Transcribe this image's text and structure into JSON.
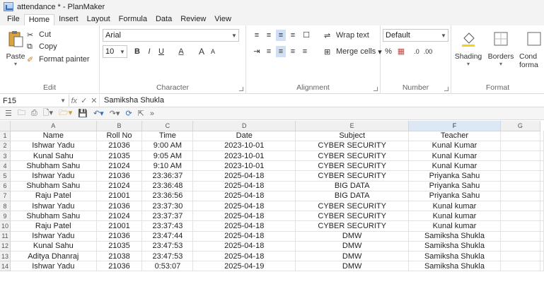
{
  "window": {
    "title": "attendance * - PlanMaker"
  },
  "menu": [
    "File",
    "Home",
    "Insert",
    "Layout",
    "Formula",
    "Data",
    "Review",
    "View"
  ],
  "ribbon": {
    "edit": {
      "label": "Edit",
      "paste": "Paste",
      "cut": "Cut",
      "copy": "Copy",
      "format_painter": "Format painter"
    },
    "character": {
      "label": "Character",
      "font": "Arial",
      "size": "10",
      "bold": "B",
      "italic": "I",
      "underline": "U",
      "font_color": "A",
      "grow": "A",
      "shrink": "A"
    },
    "alignment": {
      "label": "Alignment",
      "wrap": "Wrap text",
      "merge": "Merge cells"
    },
    "number": {
      "label": "Number",
      "format": "Default",
      "percent": "%"
    },
    "format": {
      "label": "Format",
      "shading": "Shading",
      "borders": "Borders",
      "conditional": "Cond",
      "conditional2": "forma"
    }
  },
  "formula_bar": {
    "cell": "F15",
    "fx": "fx",
    "value": "Samiksha Shukla"
  },
  "columns": [
    "A",
    "B",
    "C",
    "D",
    "E",
    "F",
    "G"
  ],
  "rows": [
    {
      "n": "1",
      "cells": [
        "Name",
        "Roll No",
        "Time",
        "Date",
        "Subject",
        "Teacher",
        ""
      ]
    },
    {
      "n": "2",
      "cells": [
        "Ishwar Yadu",
        "21036",
        "9:00 AM",
        "2023-10-01",
        "CYBER SECURITY",
        "Kunal Kumar",
        ""
      ]
    },
    {
      "n": "3",
      "cells": [
        "Kunal Sahu",
        "21035",
        "9:05 AM",
        "2023-10-01",
        "CYBER SECURITY",
        "Kunal Kumar",
        ""
      ]
    },
    {
      "n": "4",
      "cells": [
        "Shubham Sahu",
        "21024",
        "9:10 AM",
        "2023-10-01",
        "CYBER SECURITY",
        "Kunal Kumar",
        ""
      ]
    },
    {
      "n": "5",
      "cells": [
        "Ishwar Yadu",
        "21036",
        "23:36:37",
        "2025-04-18",
        "CYBER SECURITY",
        "Priyanka Sahu",
        ""
      ]
    },
    {
      "n": "6",
      "cells": [
        "Shubham Sahu",
        "21024",
        "23:36:48",
        "2025-04-18",
        "BIG DATA",
        "Priyanka Sahu",
        ""
      ]
    },
    {
      "n": "7",
      "cells": [
        "Raju Patel",
        "21001",
        "23:36:56",
        "2025-04-18",
        "BIG DATA",
        "Priyanka Sahu",
        ""
      ]
    },
    {
      "n": "8",
      "cells": [
        "Ishwar Yadu",
        "21036",
        "23:37:30",
        "2025-04-18",
        "CYBER SECURITY",
        "Kunal kumar",
        ""
      ]
    },
    {
      "n": "9",
      "cells": [
        "Shubham Sahu",
        "21024",
        "23:37:37",
        "2025-04-18",
        "CYBER SECURITY",
        "Kunal kumar",
        ""
      ]
    },
    {
      "n": "10",
      "cells": [
        "Raju Patel",
        "21001",
        "23:37:43",
        "2025-04-18",
        "CYBER SECURITY",
        "Kunal kumar",
        ""
      ]
    },
    {
      "n": "11",
      "cells": [
        "Ishwar Yadu",
        "21036",
        "23:47:44",
        "2025-04-18",
        "DMW",
        "Samiksha Shukla",
        ""
      ]
    },
    {
      "n": "12",
      "cells": [
        "Kunal Sahu",
        "21035",
        "23:47:53",
        "2025-04-18",
        "DMW",
        "Samiksha Shukla",
        ""
      ]
    },
    {
      "n": "13",
      "cells": [
        "Aditya Dhanraj",
        "21038",
        "23:47:53",
        "2025-04-18",
        "DMW",
        "Samiksha Shukla",
        ""
      ]
    },
    {
      "n": "14",
      "cells": [
        "Ishwar Yadu",
        "21036",
        "0:53:07",
        "2025-04-19",
        "DMW",
        "Samiksha Shukla",
        ""
      ]
    }
  ]
}
